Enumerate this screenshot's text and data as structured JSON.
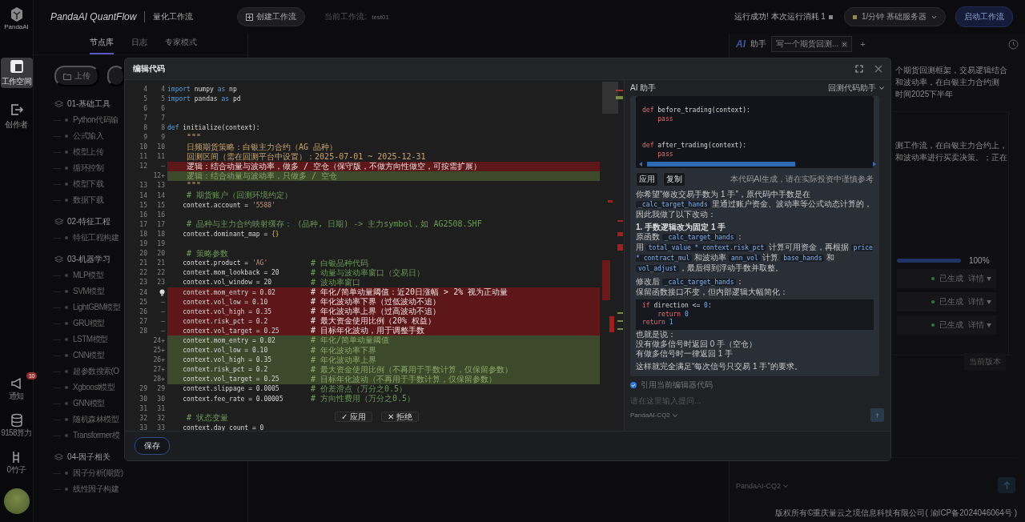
{
  "rail": {
    "logo_text": "PandaAI",
    "items": [
      {
        "label": "工作空间",
        "selected": true
      },
      {
        "label": "创作者",
        "selected": false
      }
    ],
    "bottom": [
      {
        "label": "通知",
        "badge": "10"
      },
      {
        "label": "9158算力"
      },
      {
        "label": "0竹子"
      }
    ]
  },
  "header": {
    "title": "PandaAI QuantFlow",
    "subtitle": "量化工作流",
    "create_button": "创建工作流",
    "current_label": "当前工作流:",
    "current_value": "test01",
    "run_status": "运行成功! 本次运行消耗 1",
    "rate": "1/分钟",
    "server": "基础服务器",
    "start_button": "启动工作流"
  },
  "node_panel": {
    "tabs": [
      {
        "label": "节点库",
        "selected": true
      },
      {
        "label": "日志",
        "selected": false
      },
      {
        "label": "专家模式",
        "selected": false
      }
    ],
    "upload_button": "上传",
    "groups": [
      {
        "title": "01-基础工具",
        "children": [
          {
            "label": "Python代码输"
          },
          {
            "label": "公式输入"
          },
          {
            "label": "模型上传"
          },
          {
            "label": "循环控制"
          },
          {
            "label": "模型下载"
          },
          {
            "label": "数据下载"
          }
        ]
      },
      {
        "title": "02-特征工程",
        "children": [
          {
            "label": "特征工程构建"
          }
        ]
      },
      {
        "title": "03-机器学习",
        "children": [
          {
            "label": "MLP模型"
          },
          {
            "label": "SVM模型"
          },
          {
            "label": "LightGBM模型"
          },
          {
            "label": "GRU模型"
          },
          {
            "label": "LSTM模型"
          },
          {
            "label": "CNN模型"
          },
          {
            "label": "超参数搜索(O"
          },
          {
            "label": "Xgboost模型"
          },
          {
            "label": "GNN模型"
          },
          {
            "label": "随机森林模型"
          },
          {
            "label": "Transformer模"
          }
        ]
      },
      {
        "title": "04-因子相关",
        "children": [
          {
            "label": "因子分析(期货)"
          },
          {
            "label": "线性因子构建"
          }
        ]
      }
    ]
  },
  "side": {
    "mark": "AI",
    "title": "助手",
    "session_tab": "写一个期货回测...",
    "add": "+",
    "lines_1": [
      "个期货回测框架，交易逻辑结合",
      "和波动率，在白银主力合约测",
      "时间2025下半年"
    ],
    "lines_2": [
      "测工作流，在白银主力合约上，",
      "和波动率进行买卖决策。；正在"
    ],
    "progress": {
      "level": 1,
      "reading": "100%"
    },
    "steps": [
      {
        "status": "已生成",
        "action": "详情"
      },
      {
        "status": "已生成",
        "action": "详情"
      },
      {
        "status": "已生成",
        "action": "详情"
      }
    ],
    "version_button": "当前版本",
    "model": "PandaAI-CQ2",
    "footer": "版权所有©重庆量云之境信息科技有限公司( 渝ICP备2024046064号 )"
  },
  "modal": {
    "title": "编辑代码",
    "editor": {
      "rows": [
        {
          "old": "4",
          "new": "4",
          "kind": "same",
          "code": [
            {
              "kind": "kw",
              "text": "import"
            },
            {
              "kind": "plain",
              "text": " numpy "
            },
            {
              "kind": "kw",
              "text": "as"
            },
            {
              "kind": "plain",
              "text": " np"
            }
          ]
        },
        {
          "old": "5",
          "new": "5",
          "kind": "same",
          "code": [
            {
              "kind": "kw",
              "text": "import"
            },
            {
              "kind": "plain",
              "text": " pandas "
            },
            {
              "kind": "kw",
              "text": "as"
            },
            {
              "kind": "plain",
              "text": " pd"
            }
          ]
        },
        {
          "old": "6",
          "new": "6",
          "kind": "same"
        },
        {
          "old": "7",
          "new": "7",
          "kind": "same"
        },
        {
          "old": "8",
          "new": "8",
          "kind": "same",
          "code": [
            {
              "kind": "kw",
              "text": "def"
            },
            {
              "kind": "plain",
              "text": " initialize(context):"
            }
          ]
        },
        {
          "old": "9",
          "new": "9",
          "kind": "same",
          "code": [
            {
              "kind": "doc",
              "text": "    \"\"\""
            }
          ]
        },
        {
          "old": "10",
          "new": "10",
          "kind": "same",
          "code": [
            {
              "kind": "doc",
              "text": "    日频期货策略：白银主力合约（AG 品种）"
            }
          ]
        },
        {
          "old": "11",
          "new": "11",
          "kind": "same",
          "code": [
            {
              "kind": "doc",
              "text": "    回测区间（需在回测平台中设置）：2025-07-01 ~ 2025-12-31"
            }
          ]
        },
        {
          "old": "12",
          "new": "—",
          "kind": "del",
          "code": [
            {
              "kind": "doc",
              "text": "    逻辑：结合动量与波动率，做多 / 空仓（保守版，不做方向性做空，可按需扩展）"
            }
          ]
        },
        {
          "new": "12+",
          "kind": "add",
          "code": [
            {
              "kind": "doc",
              "text": "    逻辑：结合动量与波动率，只做多 / 空仓"
            }
          ]
        },
        {
          "old": "13",
          "new": "13",
          "kind": "same",
          "code": [
            {
              "kind": "doc",
              "text": "    \"\"\""
            }
          ]
        },
        {
          "old": "14",
          "new": "14",
          "kind": "same",
          "code": [
            {
              "kind": "comment",
              "text": "    # 期货账户（回测环境约定）"
            }
          ]
        },
        {
          "old": "15",
          "new": "15",
          "kind": "same",
          "code": [
            {
              "kind": "plain",
              "text": "    context.account = "
            },
            {
              "kind": "str",
              "text": "'5588'"
            }
          ]
        },
        {
          "old": "16",
          "new": "16",
          "kind": "same"
        },
        {
          "old": "17",
          "new": "17",
          "kind": "same",
          "code": [
            {
              "kind": "comment",
              "text": "    # 品种与主力合约映射缓存： (品种, 日期) -> 主力symbol，如 AG2508.SHF"
            }
          ]
        },
        {
          "old": "18",
          "new": "18",
          "kind": "same",
          "code": [
            {
              "kind": "plain",
              "text": "    context.dominant_map = "
            },
            {
              "kind": "brace",
              "text": "{}"
            }
          ]
        },
        {
          "old": "19",
          "new": "19",
          "kind": "same"
        },
        {
          "old": "20",
          "new": "20",
          "kind": "same",
          "code": [
            {
              "kind": "comment",
              "text": "    # 策略参数"
            }
          ]
        },
        {
          "old": "21",
          "new": "21",
          "kind": "same",
          "code": [
            {
              "kind": "plain",
              "text": "    context.product = "
            },
            {
              "kind": "str",
              "text": "'AG'"
            }
          ],
          "comment": "# 白银品种代码"
        },
        {
          "old": "22",
          "new": "22",
          "kind": "same",
          "code": [
            {
              "kind": "plain",
              "text": "    context.mom_lookback = 20"
            }
          ],
          "comment": "# 动量与波动率窗口（交易日）"
        },
        {
          "old": "23",
          "new": "23",
          "kind": "same",
          "code": [
            {
              "kind": "plain",
              "text": "    context.vol_window = 20"
            }
          ],
          "comment": "# 波动率窗口"
        },
        {
          "old": "24",
          "kind": "del",
          "lightbulb": true,
          "code": [
            {
              "kind": "plain",
              "text": "    context.mom_entry = 0.02"
            }
          ],
          "comment": "# 年化/简单动量阈值：近20日涨幅 > 2% 视为正动量"
        },
        {
          "old": "25",
          "new": "—",
          "kind": "del",
          "code": [
            {
              "kind": "plain",
              "text": "    context.vol_low = 0.10"
            }
          ],
          "comment": "# 年化波动率下界（过低波动不追）"
        },
        {
          "old": "26",
          "new": "—",
          "kind": "del",
          "code": [
            {
              "kind": "plain",
              "text": "    context.vol_high = 0.35"
            }
          ],
          "comment": "# 年化波动率上界（过高波动不追）"
        },
        {
          "old": "27",
          "new": "—",
          "kind": "del",
          "code": [
            {
              "kind": "plain",
              "text": "    context.risk_pct = 0.2"
            }
          ],
          "comment": "# 最大资金使用比例（20% 权益）"
        },
        {
          "old": "28",
          "new": "—",
          "kind": "del",
          "code": [
            {
              "kind": "plain",
              "text": "    context.vol_target = 0.25"
            }
          ],
          "comment": "# 目标年化波动，用于调整手数"
        },
        {
          "new": "24+",
          "kind": "add",
          "code": [
            {
              "kind": "plain",
              "text": "    context.mom_entry = 0.02"
            }
          ],
          "comment": "# 年化/简单动量阈值"
        },
        {
          "new": "25+",
          "kind": "add",
          "code": [
            {
              "kind": "plain",
              "text": "    context.vol_low = 0.10"
            }
          ],
          "comment": "# 年化波动率下界"
        },
        {
          "new": "26+",
          "kind": "add",
          "code": [
            {
              "kind": "plain",
              "text": "    context.vol_high = 0.35"
            }
          ],
          "comment": "# 年化波动率上界"
        },
        {
          "new": "27+",
          "kind": "add",
          "code": [
            {
              "kind": "plain",
              "text": "    context.risk_pct = 0.2"
            }
          ],
          "comment": "# 最大资金使用比例（不再用于手数计算，仅保留参数）"
        },
        {
          "new": "28+",
          "kind": "add",
          "code": [
            {
              "kind": "plain",
              "text": "    context.vol_target = 0.25"
            }
          ],
          "comment": "# 目标年化波动（不再用于手数计算，仅保留参数）"
        },
        {
          "old": "29",
          "new": "29",
          "kind": "same",
          "code": [
            {
              "kind": "plain",
              "text": "    context.slippage = 0.0005"
            }
          ],
          "comment": "# 价差滑点（万分之0.5）"
        },
        {
          "old": "30",
          "new": "30",
          "kind": "same",
          "code": [
            {
              "kind": "plain",
              "text": "    context.fee_rate = 0.00005"
            }
          ],
          "comment": "# 方向性费用（万分之0.5）"
        },
        {
          "old": "31",
          "new": "31",
          "kind": "same"
        },
        {
          "old": "32",
          "new": "32",
          "kind": "same",
          "code": [
            {
              "kind": "comment",
              "text": "    # 状态变量"
            }
          ]
        },
        {
          "old": "33",
          "new": "33",
          "kind": "same",
          "code": [
            {
              "kind": "plain",
              "text": "    context.day_count = 0"
            }
          ]
        }
      ],
      "accept_button": "✓ 应用",
      "reject_button": "✕ 拒绝"
    },
    "save_button": "保存",
    "assistant": {
      "title": "AI 助手",
      "mode": "回测代码助手",
      "code_lines": [
        {
          "blank_before": false,
          "parts": [
            {
              "kind": "kw",
              "text": "def"
            },
            {
              "kind": "plain",
              "text": " before_trading(context):"
            }
          ]
        },
        {
          "blank_before": false,
          "parts": [
            {
              "kind": "kw",
              "text": "    pass"
            }
          ]
        },
        {
          "blank_before": true,
          "parts": [
            {
              "kind": "kw",
              "text": "def"
            },
            {
              "kind": "plain",
              "text": " after_trading(context):"
            }
          ]
        },
        {
          "blank_before": false,
          "parts": [
            {
              "kind": "kw",
              "text": "    pass"
            }
          ]
        }
      ],
      "apply_button": "应用",
      "copy_button": "复制",
      "disclaimer": "本代码AI生成，请在实际投资中谨慎参考",
      "message": [
        {
          "kind": "para",
          "parts": [
            {
              "kind": "text",
              "text": "你希望“修改交易手数为 1 手”，原代码中手数是在 "
            },
            {
              "kind": "code",
              "text": "_calc_target_hands"
            },
            {
              "kind": "text",
              "text": " 里通过账户资金、波动率等公式动态计算的，因此我做了以下改动："
            }
          ]
        },
        {
          "kind": "heading",
          "parts": [
            {
              "kind": "text",
              "text": "1. 手数逻辑改为固定 1 手"
            }
          ]
        },
        {
          "kind": "line",
          "parts": [
            {
              "kind": "text",
              "text": "原函数 "
            },
            {
              "kind": "code",
              "text": "_calc_target_hands"
            },
            {
              "kind": "text",
              "text": "："
            }
          ]
        },
        {
          "kind": "line",
          "parts": [
            {
              "kind": "text",
              "text": "用 "
            },
            {
              "kind": "code",
              "text": "total_value * context.risk_pct"
            },
            {
              "kind": "text",
              "text": " 计算可用资金，再根据 "
            },
            {
              "kind": "code",
              "text": "price * contract_mul"
            },
            {
              "kind": "text",
              "text": " 和波动率 "
            },
            {
              "kind": "code",
              "text": "ann_vol"
            },
            {
              "kind": "text",
              "text": " 计算 "
            },
            {
              "kind": "code",
              "text": "base_hands"
            },
            {
              "kind": "text",
              "text": " 和 "
            },
            {
              "kind": "code",
              "text": "vol_adjust"
            },
            {
              "kind": "text",
              "text": "，最后得到浮动手数并取整。"
            }
          ]
        },
        {
          "kind": "para",
          "parts": [
            {
              "kind": "text",
              "text": "修改后 "
            },
            {
              "kind": "code",
              "text": "_calc_target_hands"
            },
            {
              "kind": "text",
              "text": "："
            }
          ]
        },
        {
          "kind": "line",
          "parts": [
            {
              "kind": "text",
              "text": "保留函数接口不变，但内部逻辑大幅简化："
            }
          ]
        },
        {
          "kind": "codeblock",
          "lines": [
            [
              {
                "kind": "kw",
                "text": "if"
              },
              {
                "kind": "plain",
                "text": " direction <= "
              },
              {
                "kind": "num",
                "text": "0"
              },
              {
                "kind": "plain",
                "text": ":"
              }
            ],
            [
              {
                "kind": "kw",
                "text": "    return"
              },
              {
                "kind": "num",
                "text": " 0"
              }
            ],
            [
              {
                "kind": "kw",
                "text": "return"
              },
              {
                "kind": "num",
                "text": " 1"
              }
            ]
          ]
        },
        {
          "kind": "line",
          "parts": [
            {
              "kind": "text",
              "text": "也就是说："
            }
          ]
        },
        {
          "kind": "line",
          "parts": [
            {
              "kind": "text",
              "text": "没有做多信号时返回 0 手（空仓）"
            }
          ]
        },
        {
          "kind": "line",
          "parts": [
            {
              "kind": "text",
              "text": "有做多信号时一律返回 1 手"
            }
          ]
        },
        {
          "kind": "para",
          "parts": [
            {
              "kind": "text",
              "text": "这样就完全满足“每次信号只交易 1 手”的要求。"
            }
          ]
        }
      ],
      "use_editor_code": {
        "label": "引用当前编辑器代码",
        "checked": true
      },
      "input_placeholder": "请在这里输入提问...",
      "model": "PandaAI-CQ2"
    }
  }
}
